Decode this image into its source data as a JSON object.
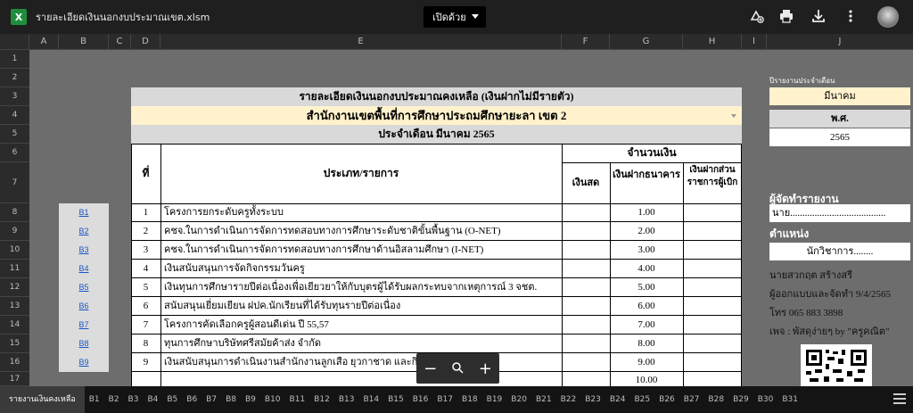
{
  "window": {
    "title": "รายละเอียดเงินนอกงบประมาณเขต.xlsm",
    "open_with": "เปิดด้วย",
    "app_letter": "X"
  },
  "columns": [
    "A",
    "B",
    "C",
    "D",
    "E",
    "F",
    "G",
    "H",
    "I",
    "J"
  ],
  "rows": [
    "1",
    "2",
    "3",
    "4",
    "5",
    "6",
    "7",
    "8",
    "9",
    "10",
    "11",
    "12",
    "13",
    "14",
    "15",
    "16",
    "17"
  ],
  "report": {
    "title": "รายละเอียดเงินนอกงบประมาณคงเหลือ (เงินฝากไม่มีรายตัว)",
    "office": "สำนักงานเขตพื้นที่การศึกษาประถมศึกษายะลา เขต 2",
    "month": "ประจำเดือน มีนาคม 2565",
    "amount_header": "จำนวนเงิน",
    "col_no": "ที่",
    "col_type": "ประเภท/รายการ",
    "col_cash": "เงินสด",
    "col_bank": "เงินฝากธนาคาร",
    "col_gov": "เงินฝากส่วนราชการผู้เบิก"
  },
  "items": [
    {
      "link": "B1",
      "no": "1",
      "name": "โครงการยกระดับครูทั้งระบบ",
      "bank": "1.00"
    },
    {
      "link": "B2",
      "no": "2",
      "name": "คชจ.ในการดำเนินการจัดการทดสอบทางการศึกษาระดับชาติขั้นพื้นฐาน (O-NET)",
      "bank": "2.00"
    },
    {
      "link": "B3",
      "no": "3",
      "name": "คชจ.ในการดำเนินการจัดการทดสอบทางการศึกษาด้านอิสลามศึกษา (I-NET)",
      "bank": "3.00"
    },
    {
      "link": "B4",
      "no": "4",
      "name": "เงินสนับสนุนการจัดกิจกรรมวันครู",
      "bank": "4.00"
    },
    {
      "link": "B5",
      "no": "5",
      "name": "เงินทุนการศึกษารายปีต่อเนื่องเพื่อเยียวยาให้กับบุตรผู้ได้รับผลกระทบจากเหตุการณ์ 3 จชต.",
      "bank": "5.00"
    },
    {
      "link": "B6",
      "no": "6",
      "name": "สนับสนุนเยี่ยมเยียน ฝปค.นักเรียนที่ได้รับทุนรายปีต่อเนื่อง",
      "bank": "6.00"
    },
    {
      "link": "B7",
      "no": "7",
      "name": "โครงการคัดเลือกครูผู้สอนดีเด่น ปี 55,57",
      "bank": "7.00"
    },
    {
      "link": "B8",
      "no": "8",
      "name": "ทุนการศึกษาบริษัทศรีสมัยค้าส่ง จำกัด",
      "bank": "8.00"
    },
    {
      "link": "B9",
      "no": "9",
      "name": "เงินสนับสนุนการดำเนินงานสำนักงานลูกเสือ ยุวกาชาด และกิจการนักเรียน",
      "bank": "9.00"
    },
    {
      "link": "",
      "no": "",
      "name": "",
      "bank": "10.00"
    }
  ],
  "side": {
    "report_monthly": "ปีรายงานประจำเดือน",
    "month_value": "มีนาคม",
    "year_label": "พ.ศ.",
    "year_value": "2565",
    "reporter_label": "ผู้จัดทำรายงาน",
    "reporter_value": "นาย.......................................",
    "position_label": "ตำแหน่ง",
    "position_value": "นักวิชาการ........",
    "author": "นายสวกฤต สร้างสรี",
    "designer": "ผู้ออกแบบและจัดทำ 9/4/2565",
    "phone": "โทร 065 883 3898",
    "page": "เพจ : พัสดุง่ายๆ by \"ครูคณิต\""
  },
  "sheet_tabs": [
    "รายงานเงินคงเหลือ",
    "B1",
    "B2",
    "B3",
    "B4",
    "B5",
    "B6",
    "B7",
    "B8",
    "B9",
    "B10",
    "B11",
    "B12",
    "B13",
    "B14",
    "B15",
    "B16",
    "B17",
    "B18",
    "B19",
    "B20",
    "B21",
    "B22",
    "B23",
    "B24",
    "B25",
    "B26",
    "B27",
    "B28",
    "B29",
    "B30",
    "B31"
  ],
  "zoom": {
    "minus": "−",
    "plus": "+"
  }
}
